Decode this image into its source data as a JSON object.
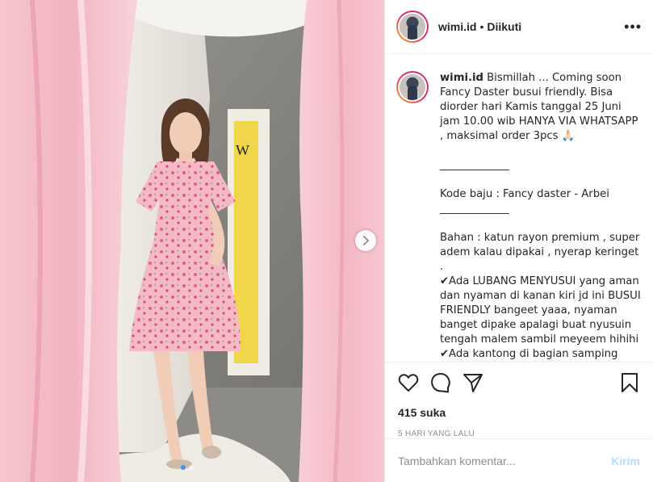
{
  "post": {
    "username": "wimi.id",
    "separator": "•",
    "follow_status": "Diikuti",
    "more_label": "•••",
    "caption_user": "wimi.id",
    "caption_text": " Bismillah ... Coming soon Fancy Daster busui friendly. Bisa diorder hari Kamis tanggal 25 Juni jam 10.00 wib HANYA VIA WHATSAPP , maksimal order 3pcs 🙏🏻\n\n_____________\n\nKode baju : Fancy daster - Arbei\n_____________\n\nBahan : katun rayon premium , super adem kalau dipakai , nyerap keringet .\n✔Ada LUBANG MENYUSUI yang aman dan nyaman di kanan kiri jd ini BUSUI FRIENDLY bangeet yaaa, nyaman banget dipake apalagi buat nyusuin tengah malem sambil meyeem hihihi\n✔Ada kantong di bagian samping kanan",
    "likes": "415 suka",
    "time": "5 HARI YANG LALU"
  },
  "comment_box": {
    "placeholder": "Tambahkan komentar...",
    "send_label": "Kirim"
  },
  "carousel": {
    "slides": 2,
    "active_index": 0
  },
  "icons": {
    "like": "heart-icon",
    "comment": "comment-icon",
    "share": "paper-plane-icon",
    "save": "bookmark-icon",
    "next": "chevron-right-icon"
  },
  "colors": {
    "accent": "#3897f0",
    "send_disabled": "#b2dffc",
    "muted": "#8e8e8e",
    "text": "#262626"
  }
}
